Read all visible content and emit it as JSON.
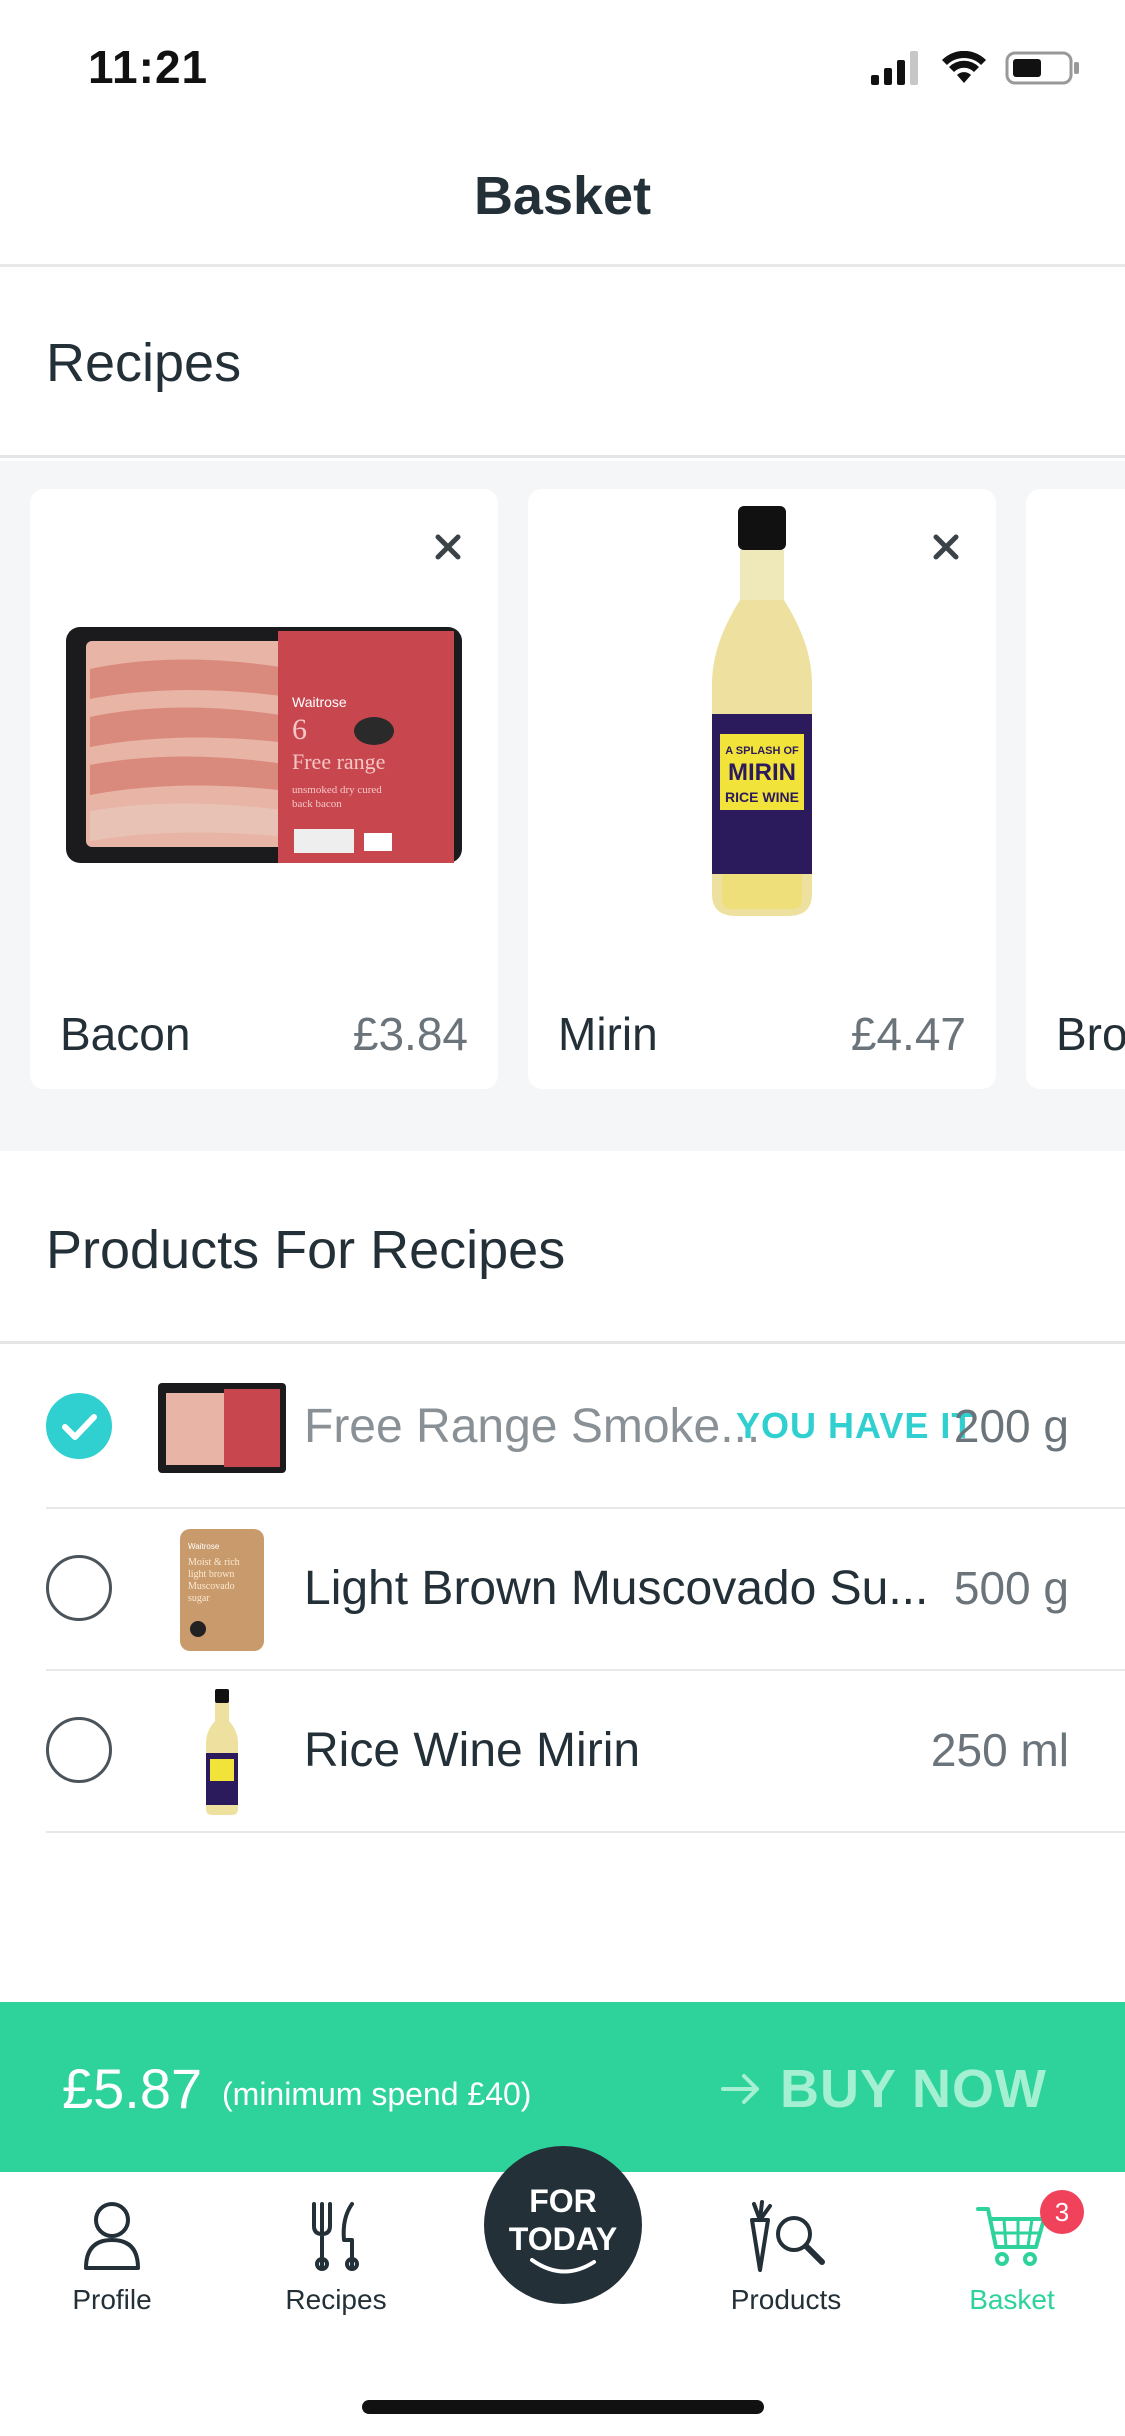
{
  "status_bar": {
    "time": "11:21"
  },
  "header": {
    "title": "Basket"
  },
  "recipes": {
    "title": "Recipes",
    "cards": [
      {
        "name": "Bacon",
        "price": "£3.84",
        "image_text": [
          "Waitrose",
          "6",
          "Free range",
          "unsmoked dry cured",
          "back bacon"
        ]
      },
      {
        "name": "Mirin",
        "price": "£4.47",
        "image_text": [
          "A SPLASH OF",
          "MIRIN",
          "RICE WINE"
        ]
      },
      {
        "name": "Bro"
      }
    ]
  },
  "products": {
    "title": "Products For Recipes",
    "items": [
      {
        "name": "Free Range Smoke...",
        "quantity": "200 g",
        "checked": true,
        "tag": "YOU HAVE IT"
      },
      {
        "name": "Light Brown Muscovado Su...",
        "quantity": "500 g",
        "checked": false,
        "image_text": [
          "Waitrose",
          "Moist & rich",
          "light brown",
          "Muscovado",
          "sugar"
        ]
      },
      {
        "name": "Rice Wine Mirin",
        "quantity": "250 ml",
        "checked": false
      }
    ]
  },
  "buy_bar": {
    "total": "£5.87",
    "minimum": "(minimum spend £40)",
    "button_label": "BUY NOW"
  },
  "tab_bar": {
    "items": [
      {
        "label": "Profile",
        "icon": "person-icon"
      },
      {
        "label": "Recipes",
        "icon": "cutlery-icon"
      },
      {
        "label": "FOR TODAY",
        "icon": "for-today-icon"
      },
      {
        "label": "Products",
        "icon": "carrot-search-icon"
      },
      {
        "label": "Basket",
        "icon": "cart-icon",
        "badge": "3",
        "active": true
      }
    ]
  },
  "colors": {
    "accent_teal": "#2fd0cf",
    "buy_green": "#2ed39b",
    "badge_red": "#f0425a",
    "text_dark": "#243038"
  }
}
